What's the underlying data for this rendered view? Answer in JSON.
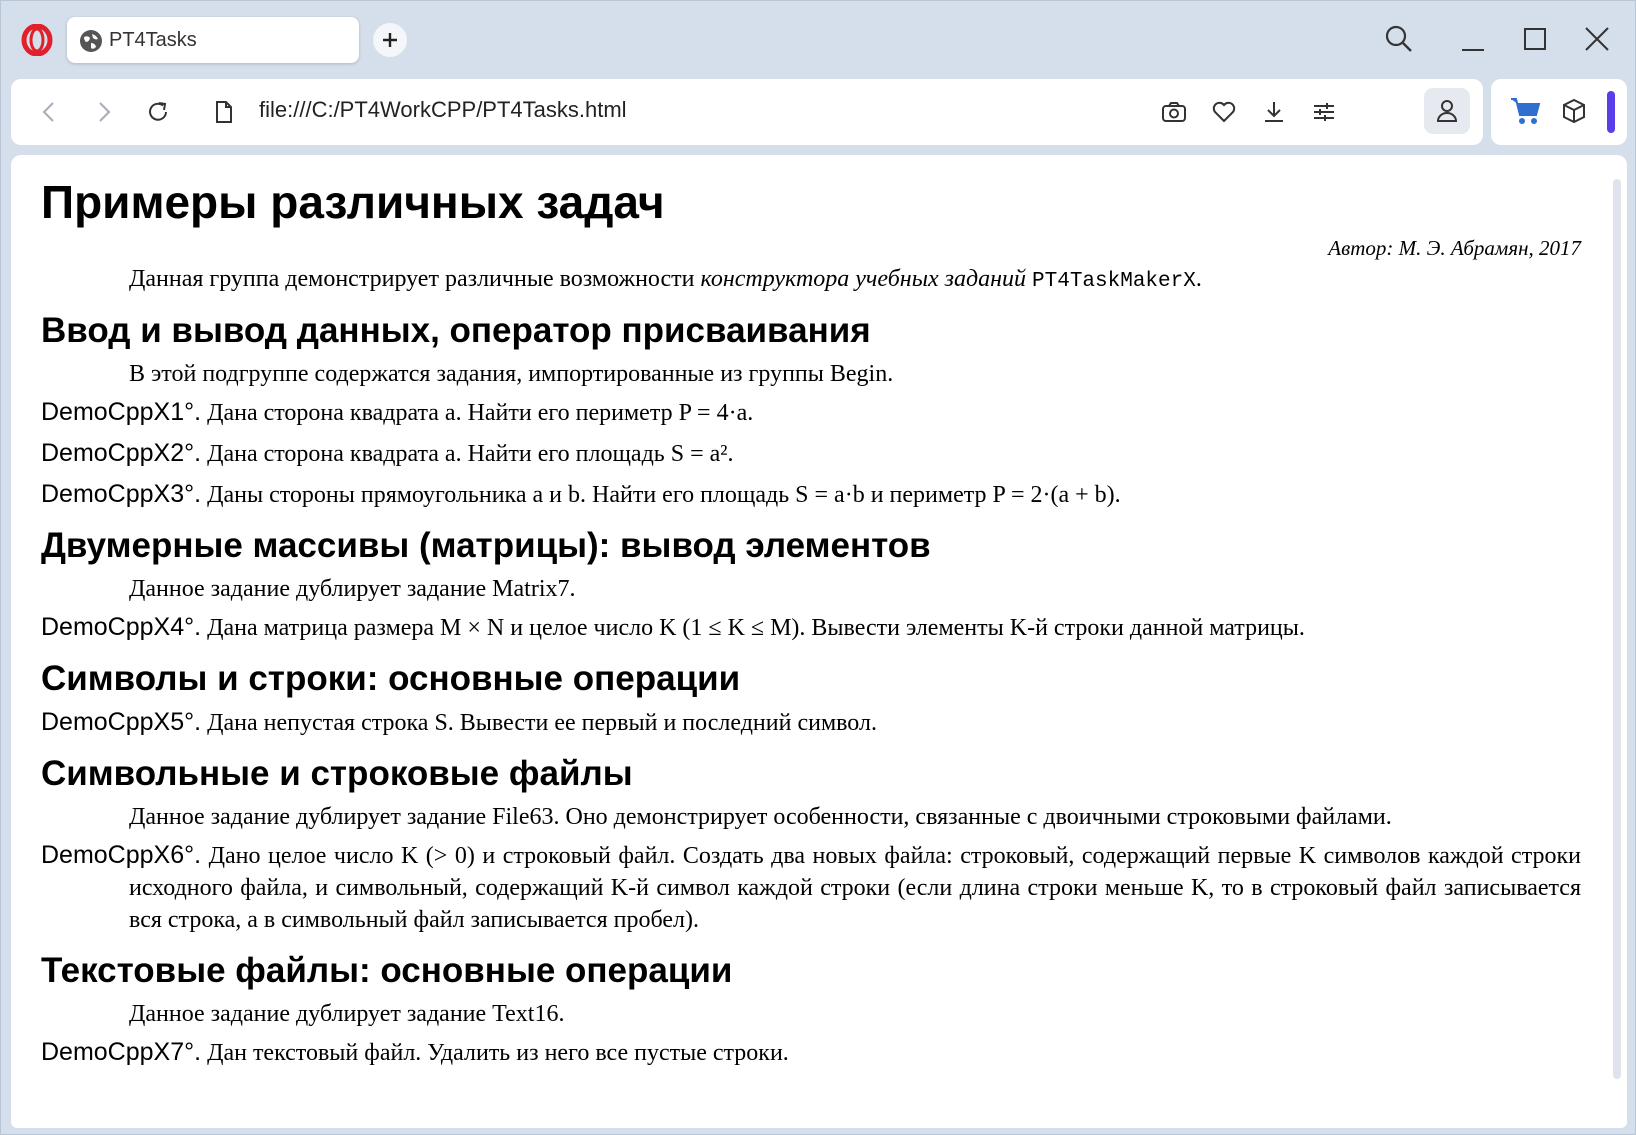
{
  "browser": {
    "tab_title": "PT4Tasks",
    "url": "file:///C:/PT4WorkCPP/PT4Tasks.html"
  },
  "page": {
    "title": "Примеры различных задач",
    "author": "Автор: М. Э. Абрамян, 2017",
    "intro": {
      "text": "Данная группа демонстрирует различные возможности ",
      "italic": "конструктора учебных заданий",
      "code": "PT4TaskMakerX",
      "end": "."
    },
    "sections": [
      {
        "heading": "Ввод и вывод данных, оператор присваивания",
        "note": "В этой подгруппе содержатся задания, импортированные из группы Begin.",
        "tasks": [
          {
            "name": "DemoCppX1°.",
            "text": "Дана сторона квадрата a. Найти его периметр P = 4·a."
          },
          {
            "name": "DemoCppX2°.",
            "text": "Дана сторона квадрата a. Найти его площадь S = a²."
          },
          {
            "name": "DemoCppX3°.",
            "text": "Даны стороны прямоугольника a и b. Найти его площадь S = a·b и периметр P = 2·(a + b)."
          }
        ]
      },
      {
        "heading": "Двумерные массивы (матрицы): вывод элементов",
        "note": "Данное задание дублирует задание Matrix7.",
        "tasks": [
          {
            "name": "DemoCppX4°.",
            "text": "Дана матрица размера M × N и целое число K (1 ≤ K ≤ M). Вывести элементы K-й строки данной матрицы."
          }
        ]
      },
      {
        "heading": "Символы и строки: основные операции",
        "note": "",
        "tasks": [
          {
            "name": "DemoCppX5°.",
            "text": "Дана непустая строка S. Вывести ее первый и последний символ."
          }
        ]
      },
      {
        "heading": "Символьные и строковые файлы",
        "note": "Данное задание дублирует задание File63. Оно демонстрирует особенности, связанные с двоичными строковыми файлами.",
        "tasks": [
          {
            "name": "DemoCppX6°.",
            "text": "Дано целое число K (> 0) и строковый файл. Создать два новых файла: строковый, содержащий первые K символов каждой строки исходного файла, и символьный, содержащий K-й символ каждой строки (если длина строки меньше K, то в строковый файл записывается вся строка, а в символьный файл записывается пробел)."
          }
        ]
      },
      {
        "heading": "Текстовые файлы: основные операции",
        "note": "Данное задание дублирует задание Text16.",
        "tasks": [
          {
            "name": "DemoCppX7°.",
            "text": "Дан текстовый файл. Удалить из него все пустые строки."
          }
        ]
      }
    ]
  },
  "colors": {
    "opera_red": "#e0202a",
    "cart_blue": "#2f6fd0",
    "accent_purple": "#5a3de8"
  }
}
